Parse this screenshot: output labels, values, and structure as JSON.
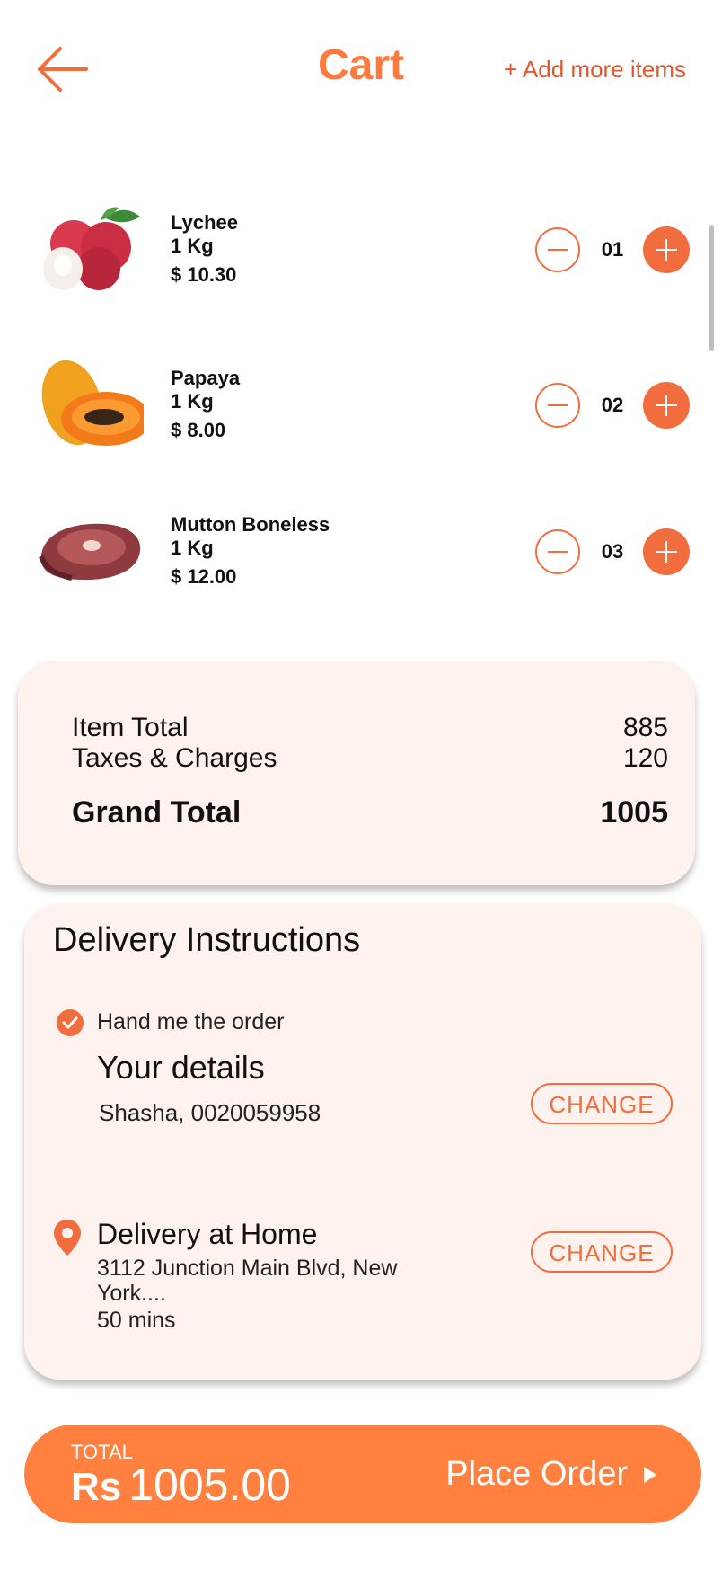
{
  "header": {
    "title": "Cart",
    "add_more": "+ Add more items"
  },
  "cart": {
    "items": [
      {
        "name": "Lychee",
        "weight": "1 Kg",
        "price": "$ 10.30",
        "qty": "01",
        "image": "lychee-image"
      },
      {
        "name": "Papaya",
        "weight": "1 Kg",
        "price": "$ 8.00",
        "qty": "02",
        "image": "papaya-image"
      },
      {
        "name": "Mutton Boneless",
        "weight": "1 Kg",
        "price": "$ 12.00",
        "qty": "03",
        "image": "mutton-image"
      }
    ]
  },
  "totals": {
    "item_total_label": "Item Total",
    "item_total_value": "885",
    "taxes_label": "Taxes & Charges",
    "taxes_value": "120",
    "grand_label": "Grand Total",
    "grand_value": "1005"
  },
  "delivery": {
    "heading": "Delivery Instructions",
    "hand_me": "Hand me the order",
    "your_details_title": "Your details",
    "your_details_value": "Shasha, 0020059958",
    "change_label": "CHANGE",
    "delivery_at": "Delivery at",
    "location": "Home",
    "address": "3112 Junction Main Blvd, New York....",
    "eta": "50 mins"
  },
  "order_bar": {
    "total_label": "TOTAL",
    "currency": "Rs",
    "amount": "1005.00",
    "place_order": "Place Order"
  },
  "colors": {
    "accent": "#F26D3D",
    "bar": "#FF803F",
    "card_bg": "#FDF2EE"
  }
}
